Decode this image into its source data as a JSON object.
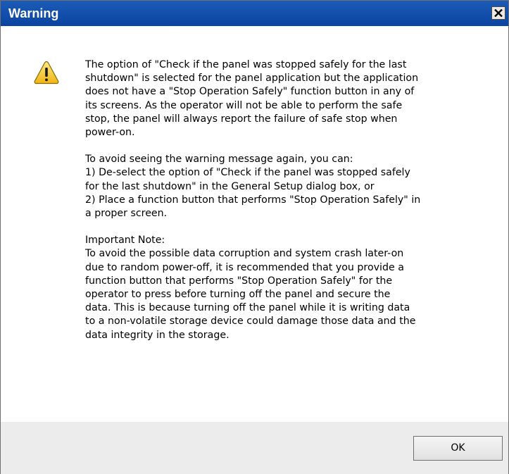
{
  "window": {
    "title": "Warning",
    "close_icon": "close-icon"
  },
  "icon": {
    "name": "warning-icon",
    "fill_color": "#f6c52b",
    "stroke_color": "#8a6d00"
  },
  "message": {
    "paragraph1": [
      "The option of \"Check if the panel was stopped safely for the last",
      "shutdown\" is selected for the panel application but the application",
      "does not have a \"Stop Operation Safely\" function button in any of",
      "its screens. As the operator will not be able to perform the safe",
      "stop, the panel will always report the failure of safe stop when",
      "power-on."
    ],
    "paragraph2": [
      "To avoid seeing the warning message again, you can:",
      "1) De-select the option of \"Check if the panel was stopped safely",
      "for the last shutdown\" in the General Setup dialog box, or",
      "2) Place a function button that performs \"Stop Operation Safely\" in",
      "a proper screen."
    ],
    "paragraph3": [
      "Important Note:",
      "To avoid the possible data corruption and system crash later-on",
      "due to random power-off, it is recommended that you provide a",
      "function button that performs \"Stop Operation Safely\" for the",
      "operator to press before turning off the panel and secure the",
      "data. This is because turning off the panel while it is writing data",
      "to a non-volatile storage device could damage those data and the",
      "data integrity in the storage."
    ]
  },
  "buttons": {
    "ok_label": "OK"
  },
  "colors": {
    "titlebar": "#0a43a0",
    "footer": "#ececec"
  }
}
